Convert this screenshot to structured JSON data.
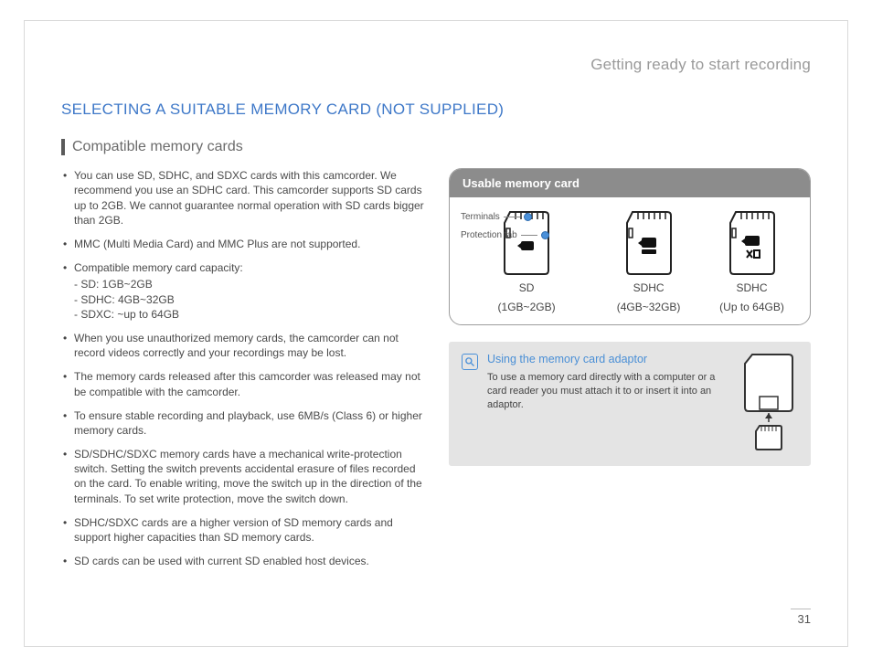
{
  "running_head": "Getting ready to start recording",
  "section_title": "SELECTING A SUITABLE MEMORY CARD (NOT SUPPLIED)",
  "subhead": "Compatible memory cards",
  "bullets": [
    {
      "text": "You can use SD, SDHC, and SDXC cards with this camcorder. We recommend you use an SDHC card. This camcorder supports SD cards up to 2GB. We cannot guarantee normal operation with SD cards bigger than 2GB."
    },
    {
      "text": "MMC (Multi Media Card) and MMC Plus are not supported."
    },
    {
      "text": "Compatible memory card capacity:",
      "sub": [
        "- SD: 1GB~2GB",
        "- SDHC: 4GB~32GB",
        "- SDXC: ~up to 64GB"
      ]
    },
    {
      "text": "When you use unauthorized memory cards, the camcorder can not record videos correctly and your recordings may be lost."
    },
    {
      "text": "The memory cards released after this camcorder was released may not be compatible with the camcorder."
    },
    {
      "text": "To ensure stable recording and playback, use 6MB/s (Class 6) or higher memory cards."
    },
    {
      "text": "SD/SDHC/SDXC memory cards have a mechanical write-protection switch. Setting the switch prevents accidental erasure of files recorded on the card. To enable writing, move the switch up in the direction of the terminals. To set write protection, move the switch down."
    },
    {
      "text": "SDHC/SDXC cards are a higher version of SD memory cards and support higher capacities than SD memory cards."
    },
    {
      "text": "SD cards can be used with current SD enabled host devices."
    }
  ],
  "panel": {
    "title": "Usable memory card",
    "annot_terminals": "Terminals",
    "annot_protection": "Protection tab",
    "cards": [
      {
        "name": "SD",
        "cap": "(1GB~2GB)"
      },
      {
        "name": "SDHC",
        "cap": "(4GB~32GB)"
      },
      {
        "name": "SDHC",
        "cap": "(Up to 64GB)"
      }
    ]
  },
  "info": {
    "title": "Using the memory card adaptor",
    "desc": "To use a memory card directly with a computer or a card reader you must attach it to or insert it into an adaptor."
  },
  "page_number": "31"
}
